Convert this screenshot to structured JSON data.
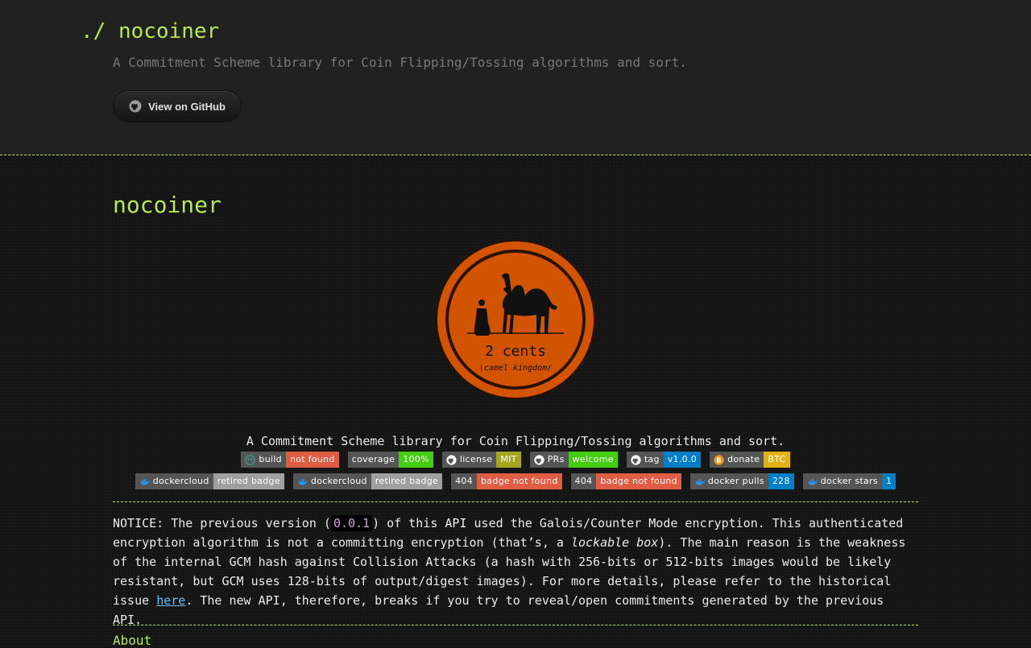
{
  "header": {
    "site_title": "./ nocoiner",
    "tagline": "A Commitment Scheme library for Coin Flipping/Tossing algorithms and sort.",
    "github_button": "View on GitHub"
  },
  "main": {
    "heading": "nocoiner",
    "logo": {
      "text_main": "2 cents",
      "text_sub": "\\camel kingdom/"
    },
    "description": "A Commitment Scheme library for Coin Flipping/Tossing algorithms and sort.",
    "badges_row1": [
      {
        "label": "build",
        "value": "not found",
        "color": "#e05d44",
        "icon": "travis-icon"
      },
      {
        "label": "coverage",
        "value": "100%",
        "color": "#4c1",
        "icon": ""
      },
      {
        "label": "license",
        "value": "MIT",
        "color": "#a4a61d",
        "icon": "github-icon"
      },
      {
        "label": "PRs",
        "value": "welcome",
        "color": "#4c1",
        "icon": "github-icon"
      },
      {
        "label": "tag",
        "value": "v1.0.0",
        "color": "#007ec6",
        "icon": "github-icon"
      },
      {
        "label": "donate",
        "value": "BTC",
        "color": "#dfb317",
        "icon": "bitcoin-icon"
      }
    ],
    "badges_row2": [
      {
        "label": "dockercloud",
        "value": "retired badge",
        "color": "#9f9f9f",
        "icon": "docker-icon"
      },
      {
        "label": "dockercloud",
        "value": "retired badge",
        "color": "#9f9f9f",
        "icon": "docker-icon"
      },
      {
        "label": "404",
        "value": "badge not found",
        "color": "#e05d44",
        "icon": ""
      },
      {
        "label": "404",
        "value": "badge not found",
        "color": "#e05d44",
        "icon": ""
      },
      {
        "label": "docker pulls",
        "value": "228",
        "color": "#007ec6",
        "icon": "docker-icon"
      },
      {
        "label": "docker stars",
        "value": "1",
        "color": "#007ec6",
        "icon": "docker-icon"
      }
    ],
    "notice": {
      "p1": "NOTICE: The previous version (",
      "code": "0.0.1",
      "p2": ") of this API used the Galois/Counter Mode encryption. This authenticated encryption algorithm is not a committing encryption (that’s, a ",
      "em": "lockable box",
      "p3": "). The main reason is the weakness of the internal GCM hash against Collision Attacks (a hash with 256-bits or 512-bits images would be likely resistant, but GCM uses 128-bits of output/digest images). For more details, please refer to the historical issue ",
      "link": "here",
      "p4": ". The new API, therefore, breaks if you try to reveal/open commitments generated by the previous API."
    },
    "about_heading": "About"
  },
  "colors": {
    "accent": "#b5e853",
    "background": "#151515",
    "header_bg": "#212121",
    "link": "#63c0f5"
  }
}
